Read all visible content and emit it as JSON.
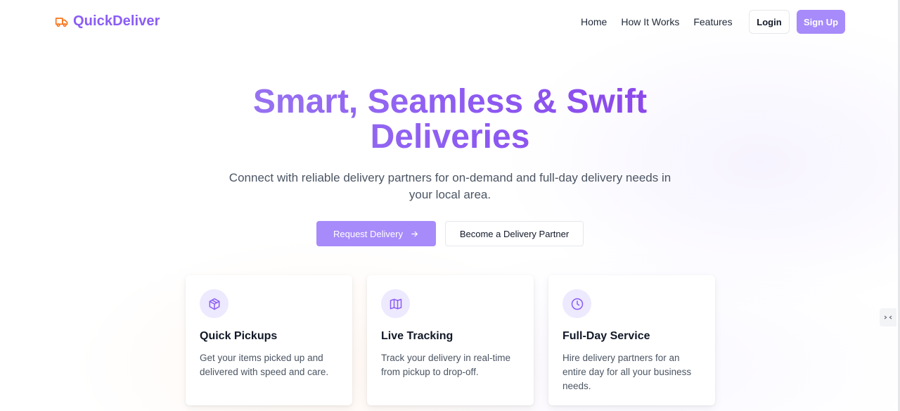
{
  "brand": {
    "name": "QuickDeliver",
    "icon": "truck-icon",
    "color": "#8b5cf6",
    "icon_color": "#f97316"
  },
  "nav": {
    "links": [
      {
        "label": "Home"
      },
      {
        "label": "How It Works"
      },
      {
        "label": "Features"
      }
    ],
    "login_label": "Login",
    "signup_label": "Sign Up"
  },
  "hero": {
    "title_line1": "Smart, Seamless & Swift",
    "title_line2": "Deliveries",
    "subtitle_line1": "Connect with reliable delivery partners for on-demand and full-day delivery needs in",
    "subtitle_line2": "your local area.",
    "primary_cta": "Request Delivery",
    "primary_cta_icon": "arrow-right-icon",
    "secondary_cta": "Become a Delivery Partner"
  },
  "features": [
    {
      "icon": "package-icon",
      "title": "Quick Pickups",
      "text": "Get your items picked up and delivered with speed and care."
    },
    {
      "icon": "map-icon",
      "title": "Live Tracking",
      "text": "Track your delivery in real-time from pickup to drop-off."
    },
    {
      "icon": "clock-icon",
      "title": "Full-Day Service",
      "text": "Hire delivery partners for an entire day for all your business needs."
    }
  ],
  "colors": {
    "accent": "#a78bfa",
    "icon_bg": "#ede9fe",
    "icon_stroke": "#8b5cf6"
  }
}
